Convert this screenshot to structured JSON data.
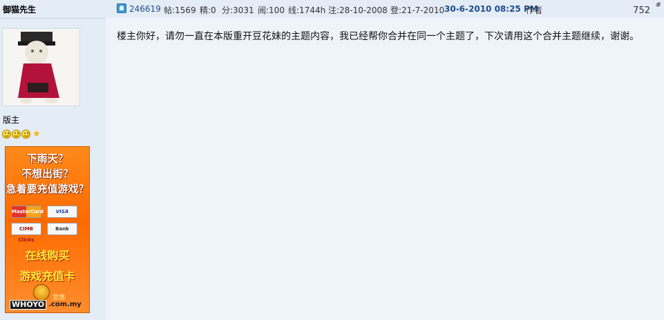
{
  "sidebar": {
    "username": "御猫先生",
    "rank_title": "版主",
    "rank_icons": [
      "smiley-icon",
      "smiley-icon",
      "smiley-icon",
      "star-icon"
    ],
    "ad": {
      "line1": "下雨天？",
      "line2": "不想出街？",
      "line3": "急着要充值游戏？",
      "cards": [
        "MasterCard",
        "VISA",
        "CIMB Clicks",
        "Bank"
      ],
      "line4": "在线购买",
      "line5": "游戏充值卡",
      "brand": "WHOYO",
      "brand_small": "忽悠",
      "domain": ".com.my"
    }
  },
  "post": {
    "uid": "246619",
    "posts": "帖:1569",
    "digest": "精:0",
    "credits": "分:3031",
    "reads": "阅:100",
    "online": "线:1744h",
    "registered": "注:28-10-2008",
    "last_login": "登:21-7-2010",
    "post_date": "30-6-2010 08:25 PM",
    "author_label": "作者",
    "floor": "752",
    "floor_sign": "#",
    "body": "楼主你好，请勿一直在本版重开豆花妹的主题内容，我已经帮你合并在同一个主题了，下次请用这个合并主题继续，谢谢。"
  },
  "colors": {
    "sidebar_bg": "#e4ecf6",
    "content_bg": "#eff4fb",
    "link": "#1e4c8a",
    "ad_orange": "#ff6a00"
  }
}
